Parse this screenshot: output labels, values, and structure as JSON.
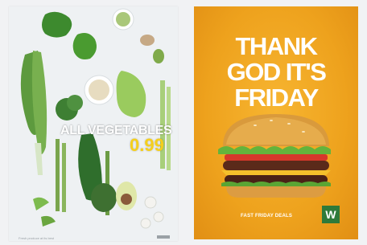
{
  "posters": {
    "vegetables": {
      "headline": "ALL VEGETABLES",
      "price": "0.99",
      "fineprint": "Fresh produce at its best"
    },
    "friday": {
      "headline_line1": "THANK",
      "headline_line2": "GOD IT'S",
      "headline_line3": "FRIDAY",
      "deals": "FAST FRIDAY DEALS",
      "badge": "W"
    }
  },
  "colors": {
    "page_background": "#f1f2f4",
    "veg_background": "#eef1f3",
    "veg_price": "#f5cf1c",
    "friday_background": "#eea21d",
    "badge_green": "#2f7a3a"
  }
}
